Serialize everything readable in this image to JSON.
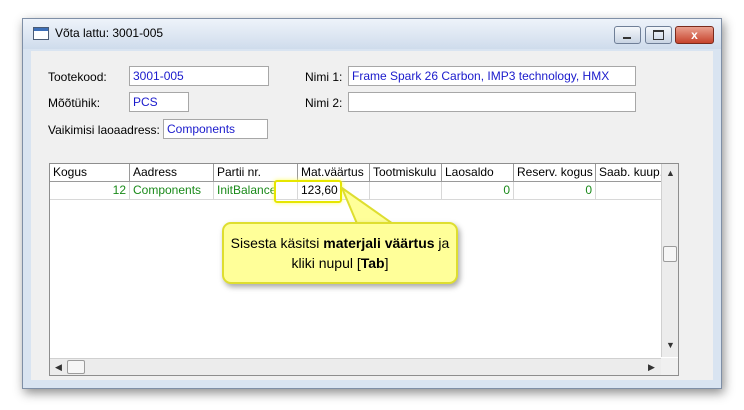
{
  "window": {
    "title": "Võta lattu: 3001-005",
    "close_glyph": "x",
    "minimize_icon": "minimize-icon",
    "maximize_icon": "maximize-icon"
  },
  "form": {
    "tootekood_label": "Tootekood:",
    "tootekood_value": "3001-005",
    "mootuhik_label": "Mõõtühik:",
    "mootuhik_value": "PCS",
    "vaikimisi_label": "Vaikimisi laoaadress:",
    "vaikimisi_value": "Components",
    "nimi1_label": "Nimi 1:",
    "nimi1_value": "Frame Spark 26 Carbon, IMP3 technology, HMX",
    "nimi2_label": "Nimi 2:",
    "nimi2_value": ""
  },
  "grid": {
    "columns": [
      "Kogus",
      "Aadress",
      "Partii nr.",
      "Mat.väärtus",
      "Tootmiskulu",
      "Laosaldo",
      "Reserv. kogus",
      "Saab. kuup."
    ],
    "rows": [
      [
        "12",
        "Components",
        "InitBalance",
        "123,60",
        "",
        "0",
        "0",
        ""
      ]
    ],
    "value_color": "#1a8a1a"
  },
  "callout": {
    "part1": "Sisesta käsitsi ",
    "bold1": "materjali väärtus",
    "part2": " ja kliki nupul [",
    "bold2": "Tab",
    "part3": "]",
    "background": "#ffff99",
    "border": "#dede30"
  },
  "colors": {
    "field_text": "#1a1acc",
    "highlight": "#e6e600"
  }
}
